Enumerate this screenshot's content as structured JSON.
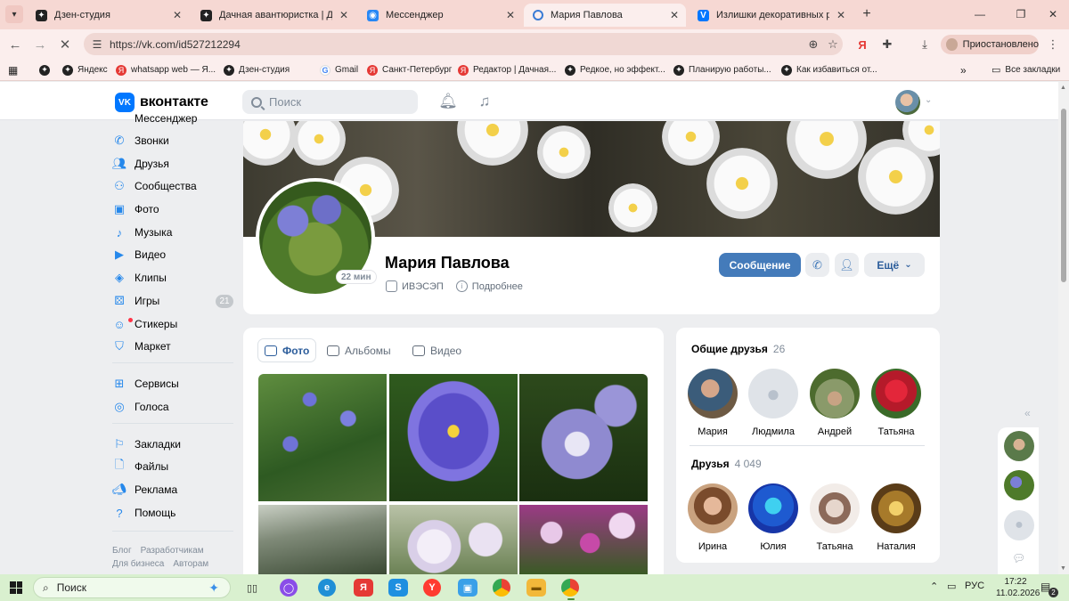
{
  "browser": {
    "tabs": [
      {
        "title": "Дзен-студия",
        "favicon": "zen-icon",
        "active": false
      },
      {
        "title": "Дачная авантюристка | Дзен",
        "favicon": "zen-icon",
        "active": false
      },
      {
        "title": "Мессенджер",
        "favicon": "messenger-icon",
        "active": false
      },
      {
        "title": "Мария Павлова",
        "favicon": "loading-icon",
        "active": true
      },
      {
        "title": "Излишки декоративных расте",
        "favicon": "vk-icon",
        "active": false
      }
    ],
    "url": "https://vk.com/id527212294",
    "profile_status": "Приостановлено",
    "bookmarks": [
      "Яндекс",
      "whatsapp web — Я...",
      "Дзен-студия",
      "Gmail",
      "Санкт-Петербург",
      "Редактор | Дачная...",
      "Редкое, но эффект...",
      "Планирую работы...",
      "Как избавиться от..."
    ],
    "all_bookmarks": "Все закладки"
  },
  "vk": {
    "logo_text": "вконтакте",
    "search_placeholder": "Поиск",
    "nav_partial": "Мессенджер",
    "nav": [
      {
        "label": "Звонки",
        "icon": "phone-icon"
      },
      {
        "label": "Друзья",
        "icon": "friends-icon"
      },
      {
        "label": "Сообщества",
        "icon": "communities-icon"
      },
      {
        "label": "Фото",
        "icon": "photo-icon"
      },
      {
        "label": "Музыка",
        "icon": "music-icon"
      },
      {
        "label": "Видео",
        "icon": "video-icon"
      },
      {
        "label": "Клипы",
        "icon": "clips-icon"
      },
      {
        "label": "Игры",
        "icon": "games-icon",
        "count": "21"
      },
      {
        "label": "Стикеры",
        "icon": "stickers-icon"
      },
      {
        "label": "Маркет",
        "icon": "market-icon"
      },
      {
        "label": "Сервисы",
        "icon": "services-icon"
      },
      {
        "label": "Голоса",
        "icon": "votes-icon"
      },
      {
        "label": "Закладки",
        "icon": "bookmarks-icon"
      },
      {
        "label": "Файлы",
        "icon": "files-icon"
      },
      {
        "label": "Реклама",
        "icon": "ads-icon"
      },
      {
        "label": "Помощь",
        "icon": "help-icon"
      }
    ],
    "footer": [
      "Блог",
      "Разработчикам",
      "Для бизнеса",
      "Авторам"
    ]
  },
  "profile": {
    "name": "Мария Павлова",
    "online": "22 мин",
    "work": "ИВЭСЭП",
    "details": "Подробнее",
    "message_button": "Сообщение",
    "more_button": "Ещё"
  },
  "photos": {
    "tabs": [
      "Фото",
      "Альбомы",
      "Видео"
    ]
  },
  "friends": {
    "mutual_title": "Общие друзья",
    "mutual_count": "26",
    "mutual": [
      "Мария",
      "Людмила",
      "Андрей",
      "Татьяна"
    ],
    "friends_title": "Друзья",
    "friends_count": "4 049",
    "list": [
      "Ирина",
      "Юлия",
      "Татьяна",
      "Наталия"
    ]
  },
  "taskbar": {
    "search": "Поиск",
    "lang": "РУС",
    "time": "17:22",
    "date": "11.02.2026",
    "notifications": "2"
  }
}
